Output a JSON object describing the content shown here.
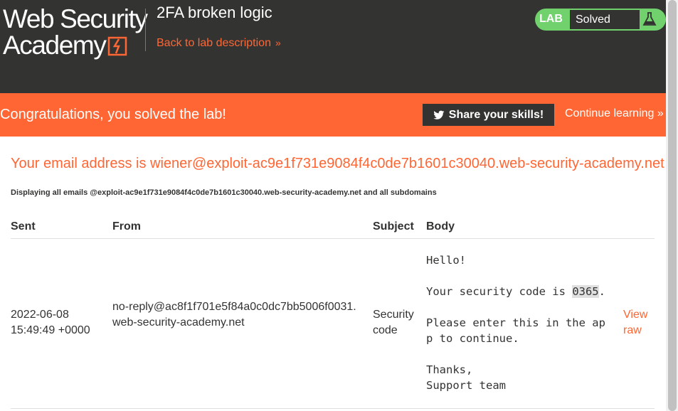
{
  "header": {
    "logo": {
      "line1": "Web Security",
      "line2": "Academy"
    },
    "lab_title": "2FA broken logic",
    "back_link": "Back to lab description",
    "status": {
      "tag": "LAB",
      "text": "Solved"
    }
  },
  "banner": {
    "message": "Congratulations, you solved the lab!",
    "share_button": "Share your skills!",
    "continue_link": "Continue learning"
  },
  "content": {
    "email_heading": "Your email address is wiener@exploit-ac9e1f731e9084f4c0de7b1601c30040.web-security-academy.net",
    "email_note": "Displaying all emails @exploit-ac9e1f731e9084f4c0de7b1601c30040.web-security-academy.net and all subdomains",
    "table": {
      "headers": [
        "Sent",
        "From",
        "Subject",
        "Body"
      ],
      "rows": [
        {
          "sent_date": "2022-06-08",
          "sent_time": "15:49:49 +0000",
          "from": "no-reply@ac8f1f701e5f84a0c0dc7bb5006f0031.web-security-academy.net",
          "subject": "Security code",
          "body_greeting": "Hello!",
          "body_code_prefix": "Your security code is ",
          "body_code": "0365",
          "body_code_suffix": ".",
          "body_line3a": "Please enter this in the ap",
          "body_line3b": "p to continue.",
          "body_thanks": "Thanks,",
          "body_signoff": "Support team",
          "view_raw": "View raw"
        }
      ]
    }
  },
  "colors": {
    "accent": "#ff6633",
    "dark": "#333332",
    "success": "#70d16d"
  },
  "icons": [
    "lightning-icon",
    "chevron-right-icon",
    "flask-icon",
    "twitter-icon"
  ]
}
